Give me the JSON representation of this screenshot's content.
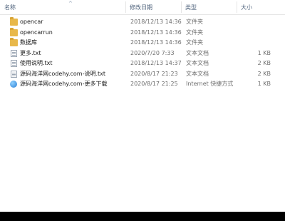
{
  "columns": {
    "name": "名称",
    "date": "修改日期",
    "type": "类型",
    "size": "大小"
  },
  "files": [
    {
      "name": "opencar",
      "date": "2018/12/13 14:36",
      "type": "文件夹",
      "size": "",
      "icon": "folder-icon"
    },
    {
      "name": "opencarrun",
      "date": "2018/12/13 14:36",
      "type": "文件夹",
      "size": "",
      "icon": "folder-icon"
    },
    {
      "name": "数据库",
      "date": "2018/12/13 14:36",
      "type": "文件夹",
      "size": "",
      "icon": "folder-icon"
    },
    {
      "name": "更多.txt",
      "date": "2020/7/20 7:33",
      "type": "文本文档",
      "size": "1 KB",
      "icon": "text-file-icon"
    },
    {
      "name": "使用说明.txt",
      "date": "2018/12/13 14:37",
      "type": "文本文档",
      "size": "2 KB",
      "icon": "text-file-icon"
    },
    {
      "name": "源码海洋网codehy.com-说明.txt",
      "date": "2020/8/17 21:23",
      "type": "文本文档",
      "size": "2 KB",
      "icon": "text-file-icon"
    },
    {
      "name": "源码海洋网codehy.com-更多下载",
      "date": "2020/8/17 21:25",
      "type": "Internet 快捷方式",
      "size": "1 KB",
      "icon": "internet-shortcut-icon"
    }
  ]
}
